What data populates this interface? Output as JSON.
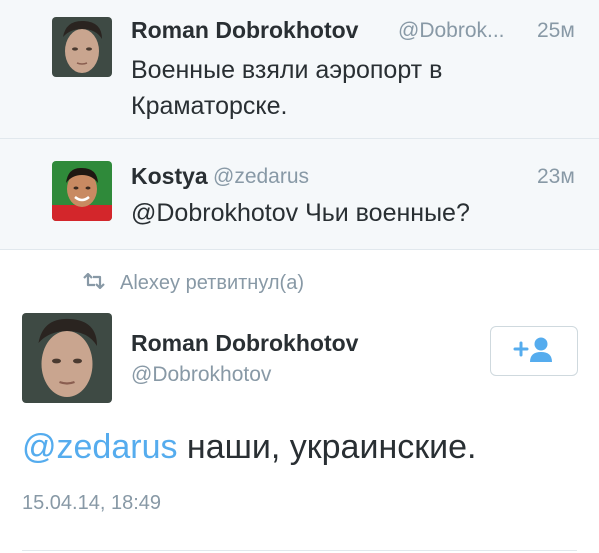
{
  "timeline": {
    "tweets": [
      {
        "author_name": "Roman Dobrokhotov",
        "author_handle": "@Dobrok...",
        "time": "25м",
        "text": "Военные взяли аэропорт в Краматорске."
      },
      {
        "author_name": "Kostya",
        "author_handle": "@zedarus",
        "time": "23м",
        "text": "@Dobrokhotov Чьи военные?"
      }
    ]
  },
  "retweet": {
    "icon": "retweet-icon",
    "label": "Alexey ретвитнул(а)"
  },
  "focused_tweet": {
    "author_name": "Roman Dobrokhotov",
    "author_handle": "@Dobrokhotov",
    "follow_icon": "follow-user-icon",
    "mention": "@zedarus",
    "text": " наши, украинские.",
    "timestamp": "15.04.14, 18:49"
  },
  "colors": {
    "link": "#55acee",
    "muted": "#8899a6",
    "text": "#292f33",
    "row_background": "#f5f8fa"
  }
}
